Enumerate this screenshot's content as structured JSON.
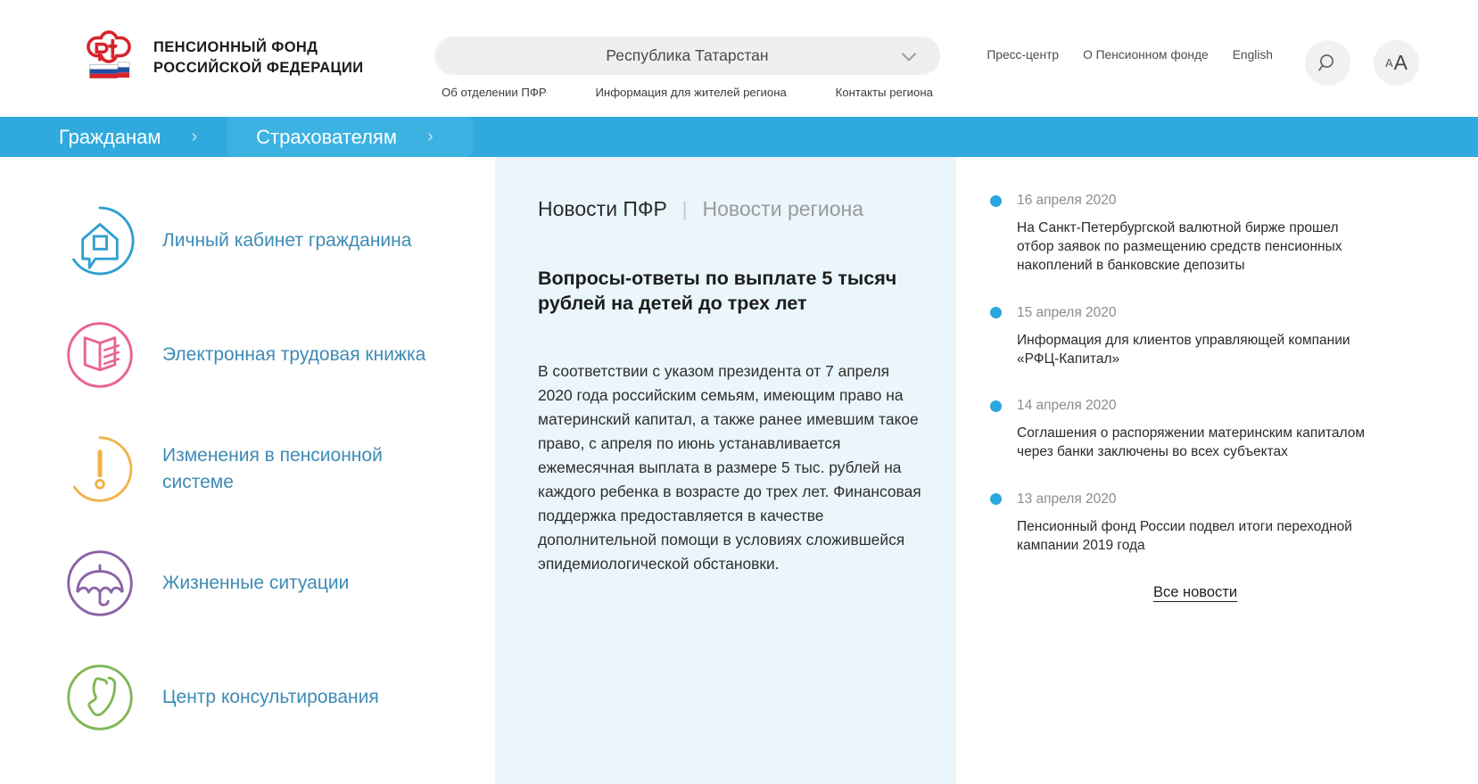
{
  "brand": {
    "line1": "ПЕНСИОННЫЙ ФОНД",
    "line2": "РОССИЙСКОЙ ФЕДЕРАЦИИ",
    "logo_icon": "pfr-logo-icon"
  },
  "header": {
    "region_selector": {
      "value": "Республика Татарстан",
      "chevron_icon": "chevron-down-icon"
    },
    "region_links": [
      {
        "label": "Об отделении  ПФР"
      },
      {
        "label": "Информация для жителей региона"
      },
      {
        "label": "Контакты региона"
      }
    ],
    "top_links": [
      {
        "label": "Пресс-центр"
      },
      {
        "label": "О Пенсионном фонде"
      },
      {
        "label": "English"
      }
    ],
    "search_icon": "search-icon",
    "fontsize": {
      "small": "A",
      "big": "A",
      "icon": "font-size-icon"
    }
  },
  "nav": {
    "tabs": [
      {
        "label": "Гражданам",
        "chevron": "›",
        "active": false
      },
      {
        "label": "Страхователям",
        "chevron": "›",
        "active": true
      }
    ]
  },
  "services": [
    {
      "label": "Личный кабинет гражданина",
      "icon": "house-chat-icon",
      "color": "#2f9fd0"
    },
    {
      "label": "Электронная трудовая книжка",
      "icon": "book-icon",
      "color": "#e8638f"
    },
    {
      "label": "Изменения в пенсионной системе",
      "icon": "exclamation-icon",
      "color": "#f2b24a"
    },
    {
      "label": "Жизненные ситуации",
      "icon": "umbrella-icon",
      "color": "#8a62a8"
    },
    {
      "label": "Центр консультирования",
      "icon": "phone-icon",
      "color": "#7fb755"
    }
  ],
  "news_panel": {
    "tabs": [
      {
        "label": "Новости ПФР",
        "active": true
      },
      {
        "label": "Новости региона",
        "active": false
      }
    ],
    "separator": "|",
    "headline": "Вопросы-ответы по выплате 5 тысяч рублей на детей до трех лет",
    "body": "В соответствии с указом президента от 7 апреля 2020 года российским семьям, имеющим право на материнский капитал, а также ранее имевшим такое право, с апреля по июнь устанавливается ежемесячная выплата в размере 5 тыс. рублей на каждого ребенка в возрасте до трех лет. Финансовая поддержка предоставляется в качестве дополнительной помощи в условиях сложившейся эпидемиологической обстановки."
  },
  "news_list": {
    "items": [
      {
        "date": "16 апреля 2020",
        "text": "На Санкт-Петербургской валютной бирже прошел отбор заявок по размещению средств пенсионных накоплений в банковские депозиты"
      },
      {
        "date": "15 апреля 2020",
        "text": "Информация для клиентов управляющей компании «РФЦ-Капитал»"
      },
      {
        "date": "14 апреля 2020",
        "text": "Соглашения о распоряжении материнским капиталом через банки заключены во всех субъектах"
      },
      {
        "date": "13 апреля 2020",
        "text": "Пенсионный фонд России подвел итоги переходной кампании 2019 года"
      }
    ],
    "all_news_label": "Все новости"
  },
  "colors": {
    "brand_blue": "#30aade",
    "panel_bg": "#eaf6fc",
    "link_blue": "#3e8bb5",
    "dot_blue": "#2ba6de"
  }
}
